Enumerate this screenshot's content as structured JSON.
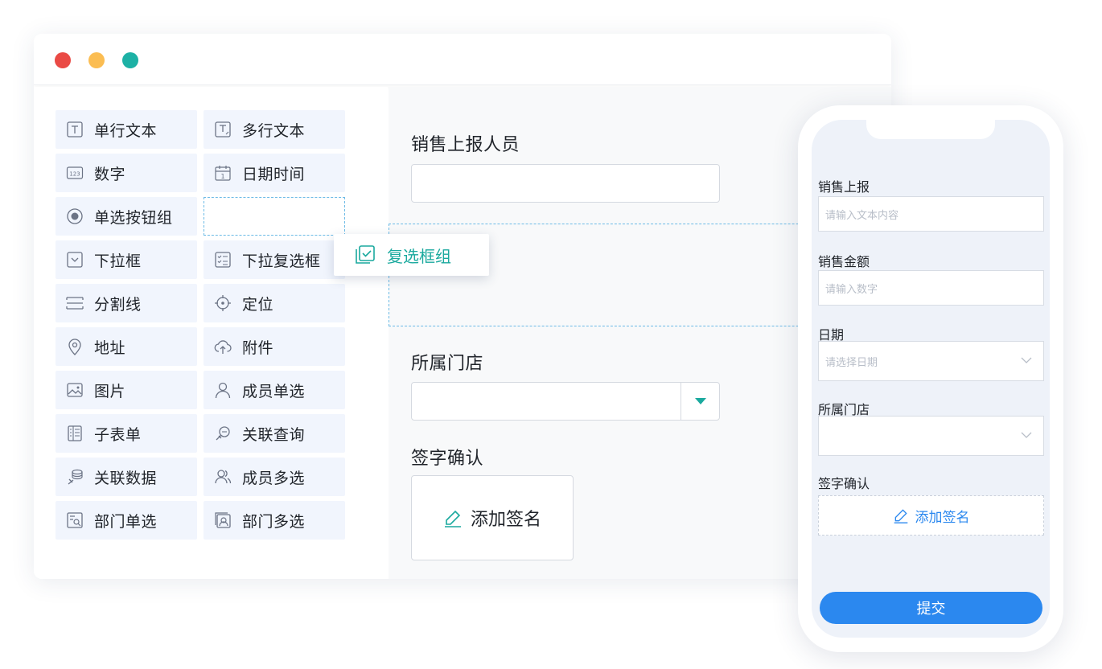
{
  "palette": {
    "items": [
      {
        "label": "单行文本",
        "icon": "text-field-icon"
      },
      {
        "label": "多行文本",
        "icon": "textarea-icon"
      },
      {
        "label": "数字",
        "icon": "number-icon",
        "icon_text": "123"
      },
      {
        "label": "日期时间",
        "icon": "calendar-icon",
        "icon_text": "1"
      },
      {
        "label": "单选按钮组",
        "icon": "radio-icon"
      },
      {
        "label": "下拉框",
        "icon": "dropdown-icon"
      },
      {
        "label": "下拉复选框",
        "icon": "checklist-icon"
      },
      {
        "label": "分割线",
        "icon": "divider-icon"
      },
      {
        "label": "定位",
        "icon": "locate-icon"
      },
      {
        "label": "地址",
        "icon": "map-pin-icon"
      },
      {
        "label": "附件",
        "icon": "upload-cloud-icon"
      },
      {
        "label": "图片",
        "icon": "image-icon"
      },
      {
        "label": "成员单选",
        "icon": "user-icon"
      },
      {
        "label": "子表单",
        "icon": "subform-icon"
      },
      {
        "label": "关联查询",
        "icon": "link-query-icon"
      },
      {
        "label": "关联数据",
        "icon": "link-data-icon"
      },
      {
        "label": "成员多选",
        "icon": "users-icon"
      },
      {
        "label": "部门单选",
        "icon": "department-icon"
      },
      {
        "label": "部门多选",
        "icon": "departments-icon"
      }
    ]
  },
  "drag_chip": {
    "label": "复选框组",
    "icon": "checkbox-group-icon"
  },
  "form": {
    "field1_label": "销售上报人员",
    "field2_label": "所属门店",
    "field3_label": "签字确认",
    "sign_label": "添加签名"
  },
  "mobile": {
    "field1_label": "销售上报",
    "field1_placeholder": "请输入文本内容",
    "field2_label": "销售金额",
    "field2_placeholder": "请输入数字",
    "field3_label": "日期",
    "field3_placeholder": "请选择日期",
    "field4_label": "所属门店",
    "field5_label": "签字确认",
    "sign_label": "添加签名",
    "submit_label": "提交"
  },
  "colors": {
    "accent_teal": "#1aa99e",
    "primary_blue": "#2b88ef",
    "palette_bg": "#f1f5fd",
    "dot_red": "#ea4a45",
    "dot_yellow": "#fbbd52",
    "dot_green": "#1db1a5"
  }
}
